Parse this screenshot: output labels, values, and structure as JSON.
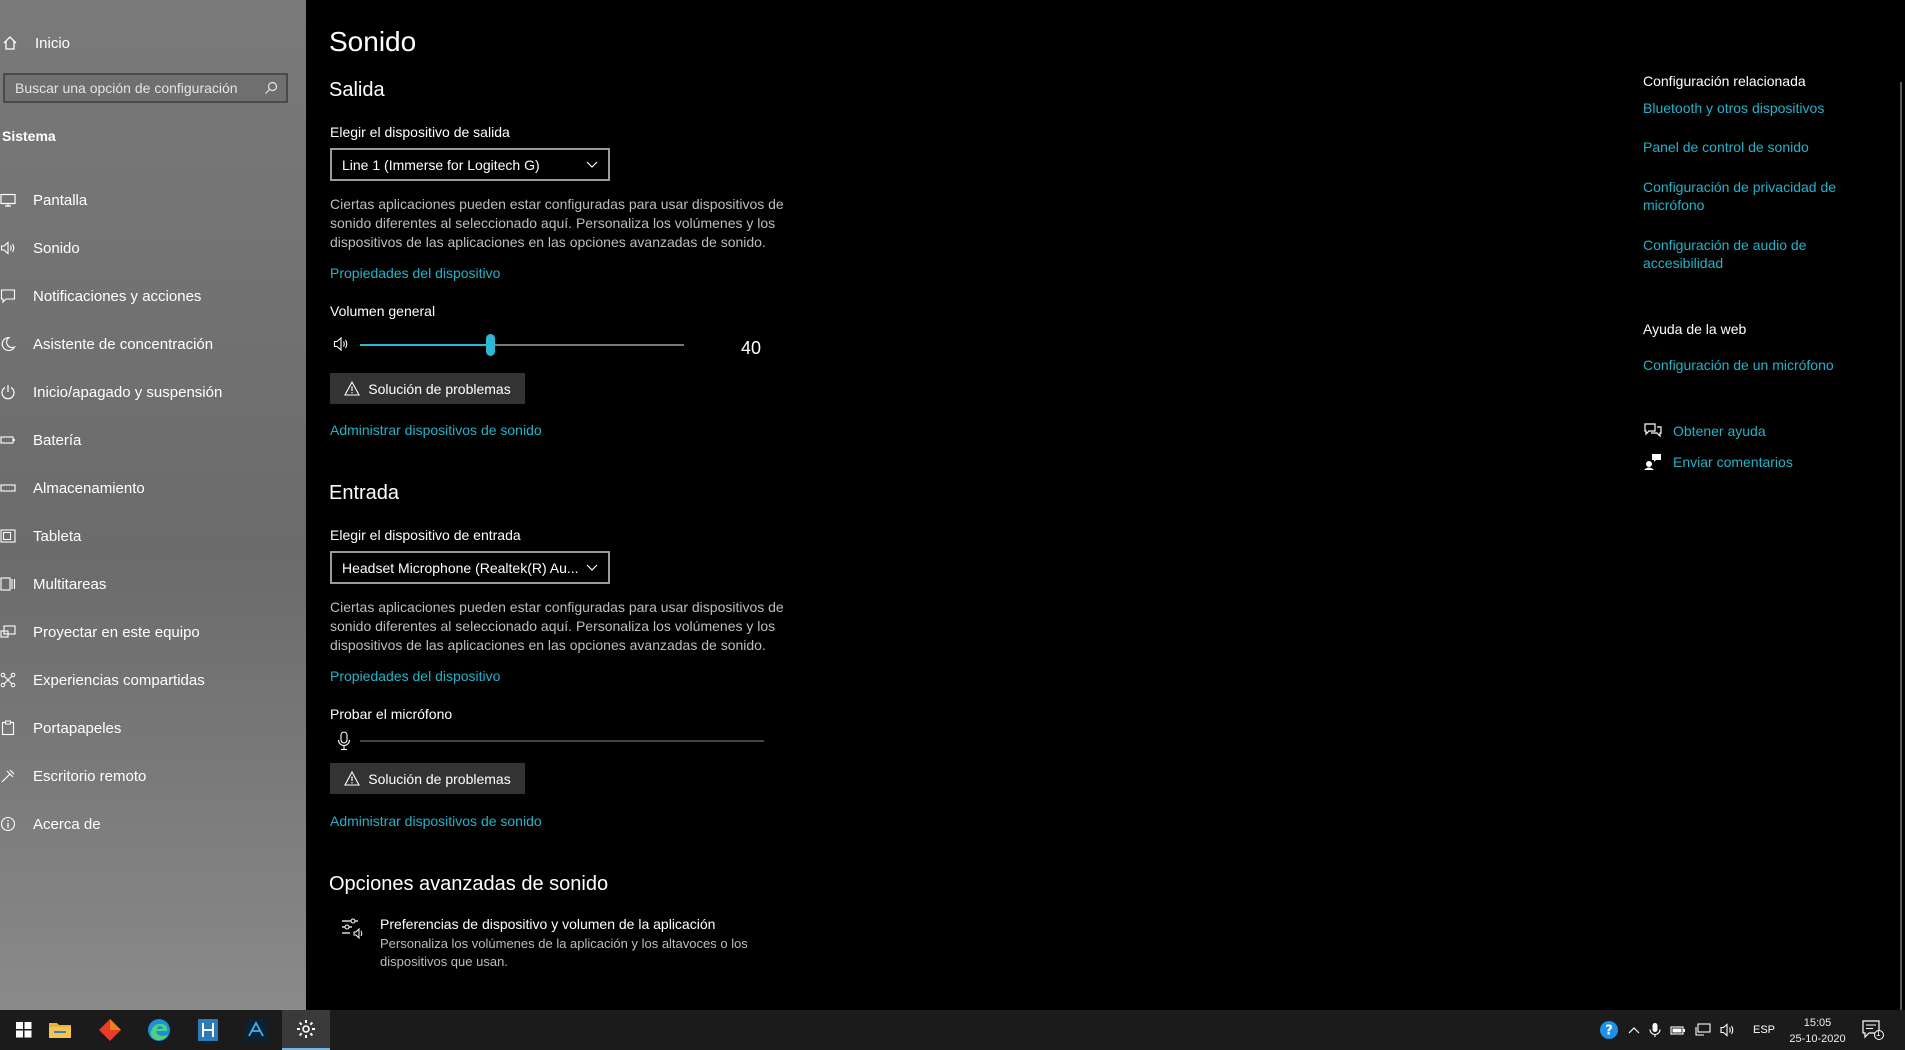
{
  "sidebar": {
    "home_label": "Inicio",
    "search_placeholder": "Buscar una opción de configuración",
    "section_title": "Sistema",
    "items": [
      {
        "label": "Pantalla",
        "icon": "monitor-icon"
      },
      {
        "label": "Sonido",
        "icon": "speaker-icon"
      },
      {
        "label": "Notificaciones y acciones",
        "icon": "notifications-icon"
      },
      {
        "label": "Asistente de concentración",
        "icon": "moon-icon"
      },
      {
        "label": "Inicio/apagado y suspensión",
        "icon": "power-icon"
      },
      {
        "label": "Batería",
        "icon": "battery-icon"
      },
      {
        "label": "Almacenamiento",
        "icon": "storage-icon"
      },
      {
        "label": "Tableta",
        "icon": "tablet-icon"
      },
      {
        "label": "Multitareas",
        "icon": "multitask-icon"
      },
      {
        "label": "Proyectar en este equipo",
        "icon": "project-icon"
      },
      {
        "label": "Experiencias compartidas",
        "icon": "shared-icon"
      },
      {
        "label": "Portapapeles",
        "icon": "clipboard-icon"
      },
      {
        "label": "Escritorio remoto",
        "icon": "remote-icon"
      },
      {
        "label": "Acerca de",
        "icon": "info-icon"
      }
    ]
  },
  "main": {
    "title": "Sonido",
    "output": {
      "heading": "Salida",
      "device_label": "Elegir el dispositivo de salida",
      "device_value": "Line 1 (Immerse for Logitech G)",
      "description": "Ciertas aplicaciones pueden estar configuradas para usar dispositivos de sonido diferentes al seleccionado aquí. Personaliza los volúmenes y los dispositivos de las aplicaciones en las opciones avanzadas de sonido.",
      "properties_link": "Propiedades del dispositivo",
      "volume_label": "Volumen general",
      "volume_value": "40",
      "volume_level": 0.4,
      "troubleshoot_label": "Solución de problemas",
      "manage_link": "Administrar dispositivos de sonido"
    },
    "input": {
      "heading": "Entrada",
      "device_label": "Elegir el dispositivo de entrada",
      "device_value": "Headset Microphone (Realtek(R) Au...",
      "description": "Ciertas aplicaciones pueden estar configuradas para usar dispositivos de sonido diferentes al seleccionado aquí. Personaliza los volúmenes y los dispositivos de las aplicaciones en las opciones avanzadas de sonido.",
      "properties_link": "Propiedades del dispositivo",
      "mic_test_label": "Probar el micrófono",
      "mic_level": 0,
      "troubleshoot_label": "Solución de problemas",
      "manage_link": "Administrar dispositivos de sonido"
    },
    "advanced": {
      "heading": "Opciones avanzadas de sonido",
      "item_title": "Preferencias de dispositivo y volumen de la aplicación",
      "item_desc": "Personaliza los volúmenes de la aplicación y los altavoces o los dispositivos que usan."
    }
  },
  "related": {
    "heading": "Configuración relacionada",
    "links": [
      "Bluetooth y otros dispositivos",
      "Panel de control de sonido",
      "Configuración de privacidad de micrófono",
      "Configuración de audio de accesibilidad"
    ],
    "web_heading": "Ayuda de la web",
    "web_link": "Configuración de un micrófono",
    "get_help": "Obtener ayuda",
    "feedback": "Enviar comentarios"
  },
  "taskbar": {
    "language": "ESP",
    "time": "15:05",
    "date": "25-10-2020",
    "notification_count": "1"
  },
  "colors": {
    "accent": "#22b3c9",
    "background": "#000000",
    "sidebar": "#6f6f6f",
    "taskbar": "#1b1b1b"
  }
}
